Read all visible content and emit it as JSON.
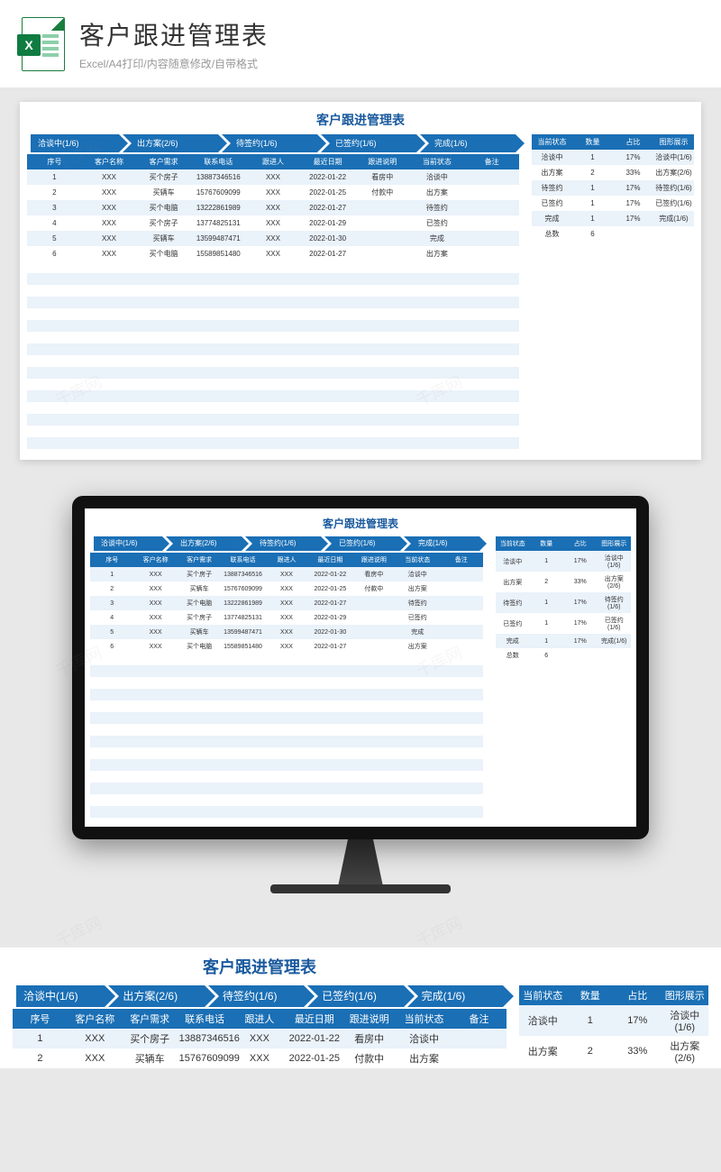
{
  "header": {
    "title": "客户跟进管理表",
    "subtitle": "Excel/A4打印/内容随意修改/自带格式",
    "icon_letter": "X"
  },
  "sheet": {
    "title": "客户跟进管理表",
    "stages": [
      "洽谈中(1/6)",
      "出方案(2/6)",
      "待签约(1/6)",
      "已签约(1/6)",
      "完成(1/6)"
    ],
    "main_headers": [
      "序号",
      "客户名称",
      "客户需求",
      "联系电话",
      "跟进人",
      "最近日期",
      "跟进说明",
      "当前状态",
      "备注"
    ],
    "main_rows": [
      [
        "1",
        "XXX",
        "买个房子",
        "13887346516",
        "XXX",
        "2022-01-22",
        "看房中",
        "洽谈中",
        ""
      ],
      [
        "2",
        "XXX",
        "买辆车",
        "15767609099",
        "XXX",
        "2022-01-25",
        "付款中",
        "出方案",
        ""
      ],
      [
        "3",
        "XXX",
        "买个电脑",
        "13222861989",
        "XXX",
        "2022-01-27",
        "",
        "待签约",
        ""
      ],
      [
        "4",
        "XXX",
        "买个房子",
        "13774825131",
        "XXX",
        "2022-01-29",
        "",
        "已签约",
        ""
      ],
      [
        "5",
        "XXX",
        "买辆车",
        "13599487471",
        "XXX",
        "2022-01-30",
        "",
        "完成",
        ""
      ],
      [
        "6",
        "XXX",
        "买个电脑",
        "15589851480",
        "XXX",
        "2022-01-27",
        "",
        "出方案",
        ""
      ]
    ],
    "side_headers": [
      "当前状态",
      "数量",
      "占比",
      "图形展示"
    ],
    "side_rows": [
      [
        "洽谈中",
        "1",
        "17%",
        "洽谈中(1/6)"
      ],
      [
        "出方案",
        "2",
        "33%",
        "出方案(2/6)"
      ],
      [
        "待签约",
        "1",
        "17%",
        "待签约(1/6)"
      ],
      [
        "已签约",
        "1",
        "17%",
        "已签约(1/6)"
      ],
      [
        "完成",
        "1",
        "17%",
        "完成(1/6)"
      ],
      [
        "总数",
        "6",
        "",
        ""
      ]
    ]
  },
  "watermark": "千库网"
}
